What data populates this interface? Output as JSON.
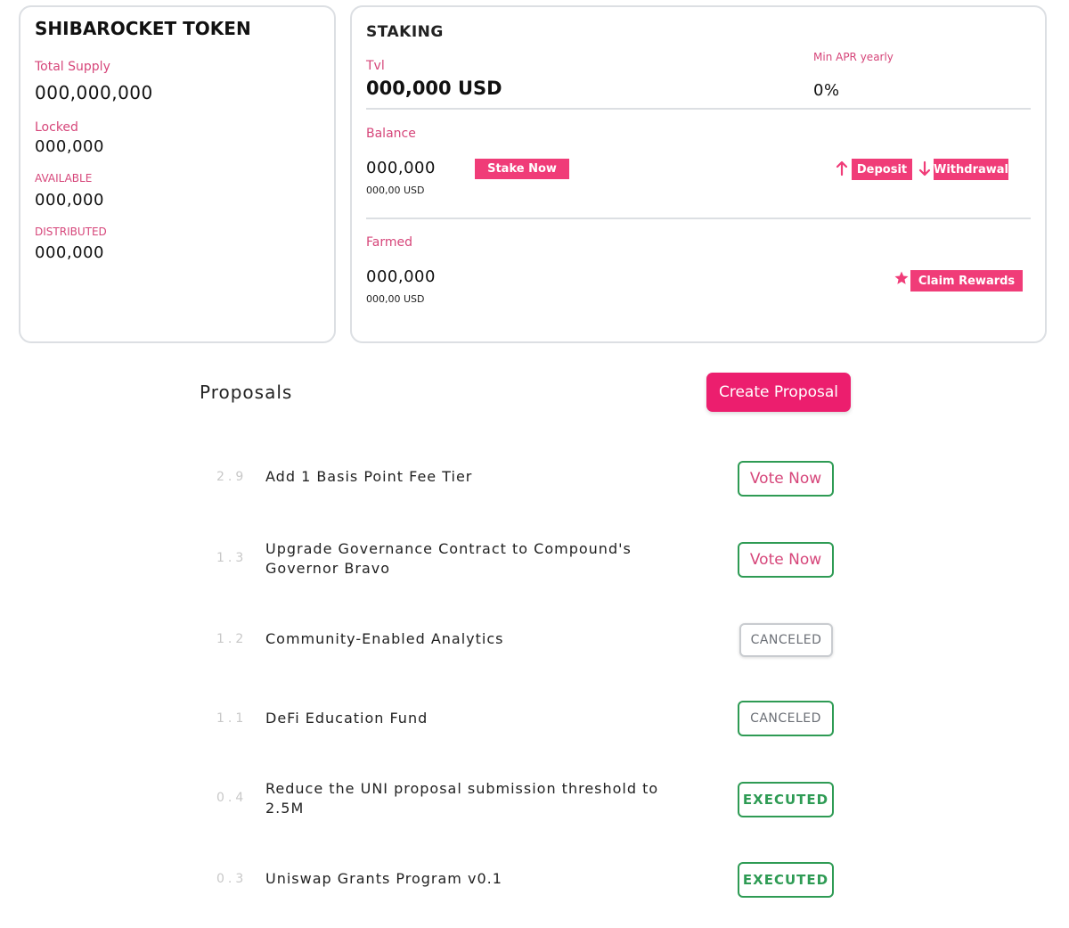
{
  "token": {
    "title": "SHIBAROCKET TOKEN",
    "total_supply_label": "Total Supply",
    "total_supply_value": "000,000,000",
    "locked_label": "Locked",
    "locked_value": "000,000",
    "available_label": "AVAILABLE",
    "available_value": "000,000",
    "distributed_label": "DISTRIBUTED",
    "distributed_value": "000,000"
  },
  "staking": {
    "title": "STAKING",
    "tvl_label": "Tvl",
    "tvl_value": "000,000 USD",
    "apr_label": "Min APR yearly",
    "apr_value": "0%",
    "balance_label": "Balance",
    "balance_value": "000,000",
    "balance_usd": "000,00 USD",
    "stake_now_label": "Stake Now",
    "deposit_label": "Deposit",
    "withdrawal_label": "Withdrawal",
    "farmed_label": "Farmed",
    "farmed_value": "000,000",
    "farmed_usd": "000,00 USD",
    "claim_rewards_label": "Claim Rewards"
  },
  "proposals": {
    "title": "Proposals",
    "create_label": "Create Proposal",
    "items": [
      {
        "number": "2.9",
        "title": "Add 1 Basis Point Fee Tier",
        "status": "Vote Now"
      },
      {
        "number": "1.3",
        "title": "Upgrade Governance Contract to Compound's Governor Bravo",
        "status": "Vote Now"
      },
      {
        "number": "1.2",
        "title": "Community-Enabled Analytics",
        "status": "CANCELED"
      },
      {
        "number": "1.1",
        "title": "DeFi Education Fund",
        "status": "CANCELED"
      },
      {
        "number": "0.4",
        "title": "Reduce the UNI proposal submission threshold to 2.5M",
        "status": "EXECUTED"
      },
      {
        "number": "0.3",
        "title": "Uniswap Grants Program v0.1",
        "status": "EXECUTED"
      }
    ]
  },
  "colors": {
    "accent_pink": "#f03c78",
    "label_pink": "#d6467a",
    "status_green": "#2e9b54",
    "card_border": "#dcdfe3"
  }
}
